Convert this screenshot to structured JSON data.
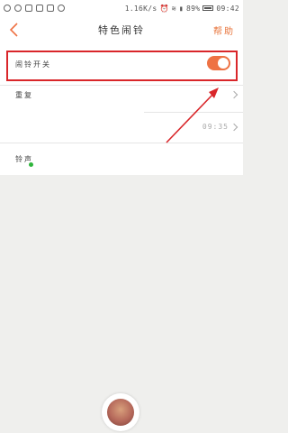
{
  "status_bar": {
    "speed": "1.16K/s",
    "battery": "89%",
    "time": "09:42"
  },
  "header": {
    "title": "特色闹铃",
    "help_label": "帮助"
  },
  "rows": {
    "alarm_switch_label": "闹铃开关",
    "repeat_label": "重复",
    "time_value": "09:35",
    "ringtone_label": "铃声"
  },
  "colors": {
    "accent": "#ee7244",
    "highlight": "#d9262a",
    "dot": "#2fb53c"
  },
  "toggle": {
    "state": "on"
  }
}
